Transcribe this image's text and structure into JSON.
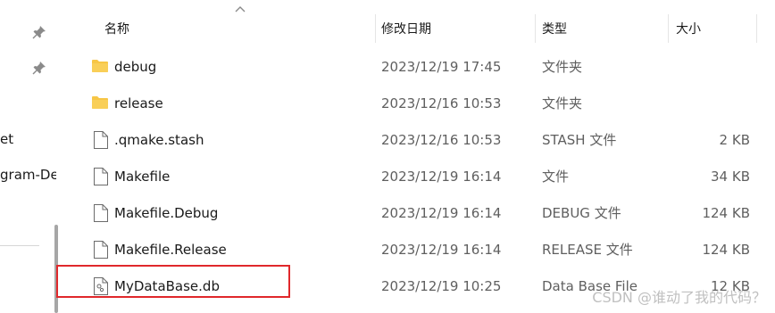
{
  "nav": {
    "partial_items": [
      {
        "label": "et"
      },
      {
        "label": "gram-De"
      }
    ]
  },
  "header": {
    "columns": [
      {
        "key": "name",
        "label": "名称"
      },
      {
        "key": "date",
        "label": "修改日期"
      },
      {
        "key": "type",
        "label": "类型"
      },
      {
        "key": "size",
        "label": "大小"
      }
    ],
    "sort_column": "name",
    "sort_direction": "ascending"
  },
  "files": [
    {
      "name": "debug",
      "modified": "2023/12/19 17:45",
      "type": "文件夹",
      "size": "",
      "icon": "folder-icon"
    },
    {
      "name": "release",
      "modified": "2023/12/16 10:53",
      "type": "文件夹",
      "size": "",
      "icon": "folder-icon"
    },
    {
      "name": ".qmake.stash",
      "modified": "2023/12/16 10:53",
      "type": "STASH 文件",
      "size": "2 KB",
      "icon": "file-icon"
    },
    {
      "name": "Makefile",
      "modified": "2023/12/19 16:14",
      "type": "文件",
      "size": "34 KB",
      "icon": "file-icon"
    },
    {
      "name": "Makefile.Debug",
      "modified": "2023/12/19 16:14",
      "type": "DEBUG 文件",
      "size": "124 KB",
      "icon": "file-icon"
    },
    {
      "name": "Makefile.Release",
      "modified": "2023/12/19 16:14",
      "type": "RELEASE 文件",
      "size": "124 KB",
      "icon": "file-icon"
    },
    {
      "name": "MyDataBase.db",
      "modified": "2023/12/19 10:25",
      "type": "Data Base File",
      "size": "12 KB",
      "icon": "database-file-icon",
      "highlighted": true
    }
  ],
  "watermark": "CSDN @谁动了我的代码？",
  "colors": {
    "folder": "#f7c646",
    "highlight_border": "#e0282b",
    "secondary_text": "#5f5f5f"
  }
}
